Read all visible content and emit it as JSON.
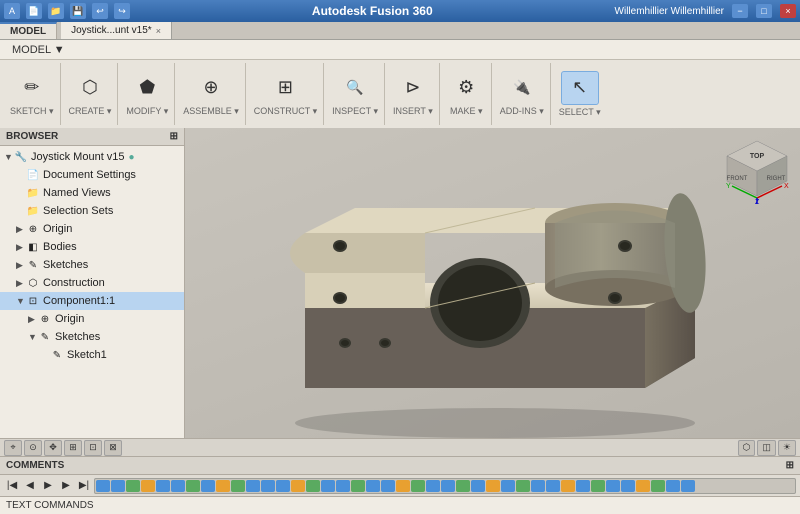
{
  "titlebar": {
    "title": "Autodesk Fusion 360",
    "user": "Willemhillier Willemhillier",
    "help": "?",
    "min_label": "−",
    "max_label": "□",
    "close_label": "×"
  },
  "menu": {
    "items": [
      "MODEL ▼"
    ]
  },
  "ribbon": {
    "groups": [
      {
        "id": "sketch",
        "label": "SKETCH ▾",
        "buttons": [
          {
            "icon": "✏",
            "label": "Sketch"
          },
          {
            "icon": "⊡",
            "label": ""
          }
        ]
      },
      {
        "id": "create",
        "label": "CREATE ▾",
        "buttons": [
          {
            "icon": "⬡",
            "label": "Create"
          },
          {
            "icon": "◫",
            "label": ""
          }
        ]
      },
      {
        "id": "modify",
        "label": "MODIFY ▾",
        "buttons": [
          {
            "icon": "⬟",
            "label": "Modify"
          },
          {
            "icon": "⌘",
            "label": ""
          }
        ]
      },
      {
        "id": "assemble",
        "label": "ASSEMBLE ▾",
        "buttons": [
          {
            "icon": "⊕",
            "label": "Assemble"
          }
        ]
      },
      {
        "id": "construct",
        "label": "CONSTRUCT ▾",
        "buttons": [
          {
            "icon": "⊞",
            "label": "Construct"
          }
        ]
      },
      {
        "id": "inspect",
        "label": "INSPECT ▾",
        "buttons": [
          {
            "icon": "🔍",
            "label": "Inspect"
          }
        ]
      },
      {
        "id": "insert",
        "label": "INSERT ▾",
        "buttons": [
          {
            "icon": "⊳",
            "label": "Insert"
          }
        ]
      },
      {
        "id": "make",
        "label": "MAKE ▾",
        "buttons": [
          {
            "icon": "⚙",
            "label": "Make"
          }
        ]
      },
      {
        "id": "addins",
        "label": "ADD-INS ▾",
        "buttons": [
          {
            "icon": "🔌",
            "label": "Add-Ins"
          }
        ]
      },
      {
        "id": "select",
        "label": "SELECT ▾",
        "buttons": [
          {
            "icon": "↖",
            "label": "Select"
          }
        ]
      }
    ]
  },
  "workspace_tab": {
    "label": "MODEL"
  },
  "file_tabs": [
    {
      "label": "Joystick...unt v15*",
      "active": true,
      "closable": true
    }
  ],
  "browser": {
    "title": "BROWSER",
    "expand_icon": "⊞",
    "tree": [
      {
        "indent": 0,
        "arrow": "▼",
        "icon": "🔧",
        "label": "Joystick Mount v15",
        "extra": "●"
      },
      {
        "indent": 1,
        "arrow": " ",
        "icon": "📄",
        "label": "Document Settings"
      },
      {
        "indent": 1,
        "arrow": " ",
        "icon": "📁",
        "label": "Named Views"
      },
      {
        "indent": 1,
        "arrow": " ",
        "icon": "📁",
        "label": "Selection Sets"
      },
      {
        "indent": 1,
        "arrow": "▶",
        "icon": "⊕",
        "label": "Origin"
      },
      {
        "indent": 1,
        "arrow": "▶",
        "icon": "◧",
        "label": "Bodies"
      },
      {
        "indent": 1,
        "arrow": "▶",
        "icon": "✎",
        "label": "Sketches"
      },
      {
        "indent": 1,
        "arrow": "▶",
        "icon": "⬡",
        "label": "Construction"
      },
      {
        "indent": 1,
        "arrow": "▼",
        "icon": "⊡",
        "label": "Component1:1"
      },
      {
        "indent": 2,
        "arrow": "▶",
        "icon": "⊕",
        "label": "Origin"
      },
      {
        "indent": 2,
        "arrow": "▼",
        "icon": "✎",
        "label": "Sketches"
      },
      {
        "indent": 3,
        "arrow": " ",
        "icon": "✎",
        "label": "Sketch1"
      }
    ]
  },
  "comments": {
    "title": "COMMENTS",
    "icon": "⊞"
  },
  "text_commands": {
    "label": "TEXT COMMANDS"
  },
  "timeline": {
    "play_back": "◀◀",
    "step_back": "◀",
    "play_pause": "▶",
    "step_fwd": "▶",
    "play_fwd": "▶▶",
    "items_colors": [
      "#4a90d9",
      "#4a90d9",
      "#5aaa60",
      "#e8a030",
      "#4a90d9",
      "#4a90d9",
      "#5aaa60",
      "#4a90d9",
      "#e8a030",
      "#5aaa60",
      "#4a90d9",
      "#4a90d9",
      "#4a90d9",
      "#e8a030",
      "#5aaa60",
      "#4a90d9",
      "#4a90d9",
      "#5aaa60",
      "#4a90d9",
      "#4a90d9",
      "#e8a030",
      "#5aaa60",
      "#4a90d9",
      "#4a90d9",
      "#5aaa60",
      "#4a90d9",
      "#e8a030",
      "#4a90d9",
      "#5aaa60",
      "#4a90d9",
      "#4a90d9",
      "#e8a030",
      "#4a90d9",
      "#5aaa60",
      "#4a90d9",
      "#4a90d9",
      "#e8a030",
      "#5aaa60",
      "#4a90d9",
      "#4a90d9"
    ]
  },
  "nav_cube": {
    "top_label": "TOP",
    "front_label": "FRONT",
    "right_label": "RIGHT",
    "home_label": "⌂"
  },
  "bottom_nav": {
    "buttons": [
      "⌖",
      "⊙",
      "⊞",
      "⊠",
      "⬡",
      "◫",
      "⊿",
      "⊳",
      "⊡"
    ]
  }
}
